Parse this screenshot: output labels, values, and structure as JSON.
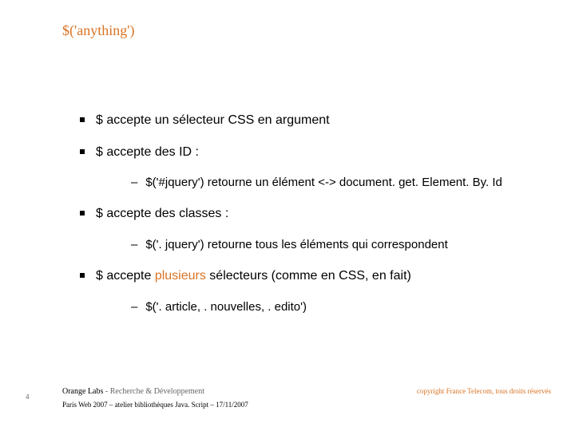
{
  "title": "$('anything')",
  "bullets": [
    {
      "level": 1,
      "text": "$ accepte un sélecteur CSS en argument",
      "accent": false
    },
    {
      "level": 1,
      "text": "$ accepte des ID :",
      "accent": false
    },
    {
      "level": 2,
      "text": "$('#jquery') retourne un élément <-> document. get. Element. By. Id",
      "accent": false
    },
    {
      "level": 1,
      "text": "$ accepte des classes :",
      "accent": false
    },
    {
      "level": 2,
      "text": "$('. jquery') retourne tous les éléments qui correspondent",
      "accent": false
    },
    {
      "level": 1,
      "prefix": "$ accepte ",
      "accentText": "plusieurs",
      "suffix": " sélecteurs (comme en CSS, en fait)",
      "accent": true
    },
    {
      "level": 2,
      "text": "$('. article, . nouvelles, . edito')",
      "accent": false
    }
  ],
  "footer": {
    "org": "Orange Labs",
    "dept": "Recherche & Développement",
    "copyright": "copyright France Telecom, tous droits réservés",
    "event": "Paris Web 2007 – atelier bibliothèques Java. Script – 17/11/2007"
  },
  "pageNum": "4"
}
